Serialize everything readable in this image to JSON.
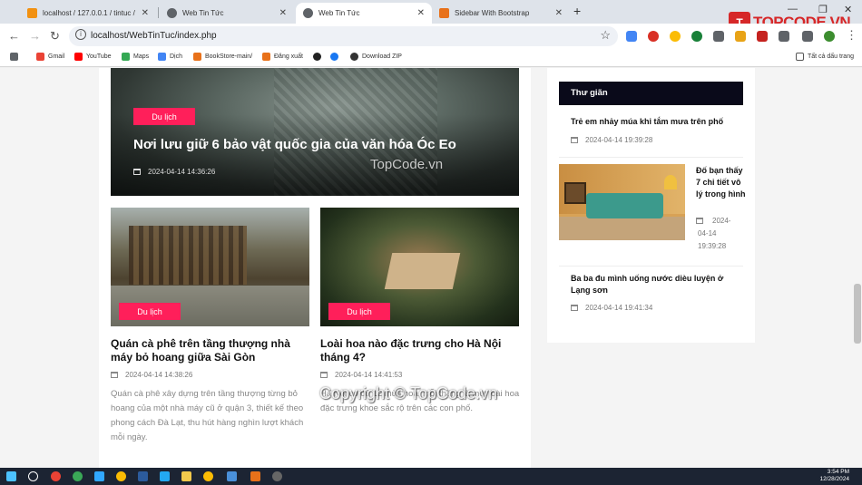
{
  "browser": {
    "tabs": [
      {
        "title": "localhost / 127.0.0.1 / tintuc / user",
        "favicon_color": "#f29111"
      },
      {
        "title": "Web Tin Tức",
        "favicon_color": "#5f6368"
      },
      {
        "title": "Web Tin Tức",
        "favicon_color": "#5f6368",
        "active": true
      },
      {
        "title": "Sidebar With Bootstrap",
        "favicon_color": "#e8711a"
      }
    ],
    "url": "localhost/WebTinTuc/index.php",
    "bookmarks": [
      {
        "label": "Gmail",
        "color": "#ea4335"
      },
      {
        "label": "YouTube",
        "color": "#ff0000"
      },
      {
        "label": "Maps",
        "color": "#34a853"
      },
      {
        "label": "Dịch",
        "color": "#4285f4"
      },
      {
        "label": "BookStore-main/",
        "color": "#e8711a"
      },
      {
        "label": "Đăng xuất",
        "color": "#e8711a"
      },
      {
        "label": "",
        "color": "#222222"
      },
      {
        "label": "",
        "color": "#1877f2"
      },
      {
        "label": "Download ZIP",
        "color": "#333333"
      }
    ],
    "all_bookmarks_label": "Tất cả dấu trang"
  },
  "hero": {
    "category": "Du lịch",
    "title": "Nơi lưu giữ 6 bảo vật quốc gia của văn hóa Óc Eo",
    "date": "2024-04-14 14:36:26",
    "watermark": "TopCode.vn"
  },
  "articles": [
    {
      "category": "Du lịch",
      "title": "Quán cà phê trên tầng thượng nhà máy bỏ hoang giữa Sài Gòn",
      "date": "2024-04-14 14:38:26",
      "description": "Quán cà phê xây dựng trên tầng thượng từng bỏ hoang của một nhà máy cũ ở quận 3, thiết kế theo phong cách Đà Lạt, thu hút hàng nghìn lượt khách mỗi ngày."
    },
    {
      "category": "Du lịch",
      "title": "Loài hoa nào đặc trưng cho Hà Nội tháng 4?",
      "date": "2024-04-14 14:41:53",
      "description": "Hà Nội có đủ 12 mùa hoa, mỗi tháng là một loài hoa đặc trưng khoe sắc rộ trên các con phố."
    }
  ],
  "sidebar": {
    "heading": "Thư giãn",
    "items": [
      {
        "title": "Trẻ em nhảy múa khi tắm mưa trên phố",
        "date": "2024-04-14 19:39:28"
      },
      {
        "title": "Đố bạn thấy 7 chi tiết vô lý trong hình",
        "date_line1": "2024-",
        "date_line2": "04-14",
        "date_line3": "19:39:28"
      },
      {
        "title": "Ba ba đu mình uống nước dièu luyện ở Lạng sơn",
        "date": "2024-04-14 19:41:34"
      }
    ]
  },
  "logo": {
    "text": "TOPCODE.VN",
    "mark": "T"
  },
  "copyright_watermark": "Copyright © TopCode.vn",
  "taskbar": {
    "time": "3:54 PM",
    "date": "12/28/2024"
  }
}
